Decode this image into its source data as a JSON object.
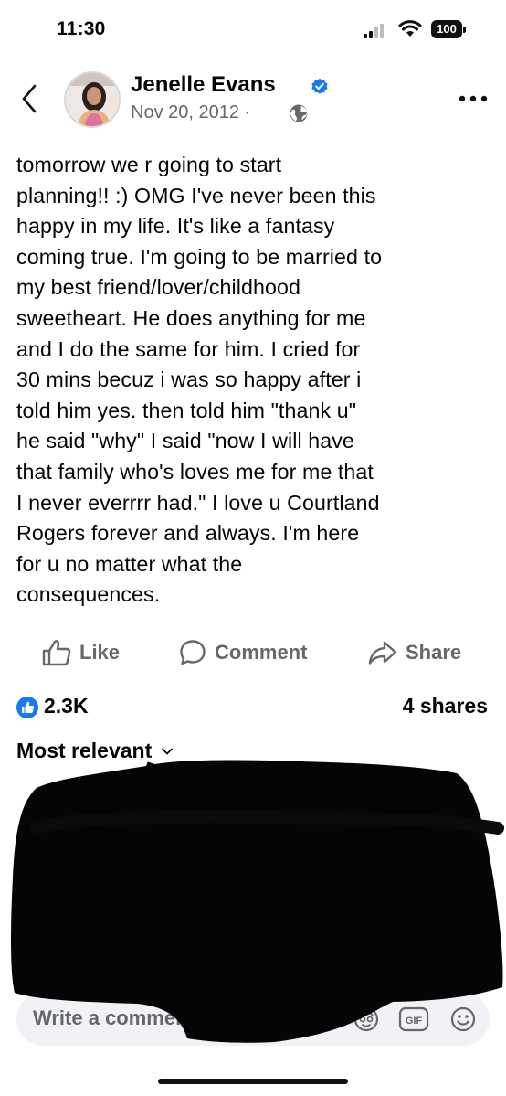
{
  "status_bar": {
    "time": "11:30",
    "battery": "100"
  },
  "post": {
    "author": "Jenelle Evans",
    "date": "Nov 20, 2012 ·",
    "verified": true,
    "privacy_icon": "globe-icon",
    "text": "tomorrow we r going to start\nplanning!! :) OMG I've never been this\nhappy in my life. It's like a fantasy\ncoming true. I'm going to be married to\nmy best friend/lover/childhood\nsweetheart. He does anything for me\nand I do the same for him. I cried for\n30 mins becuz i was so happy after i\ntold him yes. then told him \"thank u\"\nhe said \"why\" I said \"now I will have\nthat family who's loves me for me that\nI never everrrr had.\" I love u Courtland\nRogers forever and always. I'm here\nfor u no matter what the\nconsequences."
  },
  "actions": {
    "like": "Like",
    "comment": "Comment",
    "share": "Share"
  },
  "stats": {
    "likes": "2.3K",
    "shares": "4 shares"
  },
  "comments": {
    "sort_label": "Most relevant",
    "input_placeholder": "Write a comment..."
  },
  "colors": {
    "accent": "#1877f2",
    "muted": "#65676b",
    "input_bg": "#f0f2f5"
  }
}
